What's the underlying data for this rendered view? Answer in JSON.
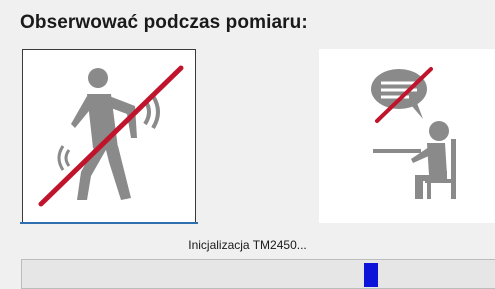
{
  "heading": "Obserwować podczas pomiaru:",
  "options": [
    {
      "icon": "person-moving-crossed-icon",
      "selected": true
    },
    {
      "icon": "person-talking-crossed-icon",
      "selected": false
    }
  ],
  "status_text": "Inicjalizacja TM2450...",
  "colors": {
    "accent": "#2f6fb0",
    "cross_line": "#c0142c",
    "figure": "#8a8a8a",
    "progress_chunk": "#0b14d8"
  },
  "progress": {
    "indeterminate": true
  }
}
